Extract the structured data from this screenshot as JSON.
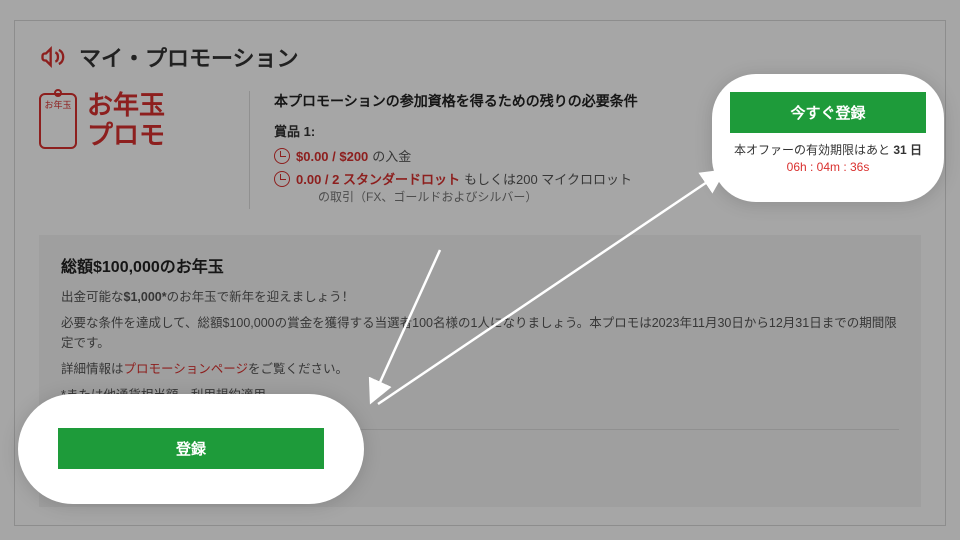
{
  "heading": "マイ・プロモーション",
  "logo": {
    "mark": "お年玉",
    "line1": "お年玉",
    "line2": "プロモ"
  },
  "req": {
    "title": "本プロモーションの参加資格を得るための残りの必要条件",
    "prize": "賞品 1:",
    "l1": "$0.00 / $200",
    "l1s": "の入金",
    "l2": "0.00 / 2 スタンダードロット",
    "l2s": "もしくは200 マイクロロット",
    "l2d": "の取引（FX、ゴールドおよびシルバー）"
  },
  "cta": {
    "topBtn": "今すぐ登録",
    "expPrefix": "本オファーの有効期限はあと ",
    "expDays": "31 日",
    "countdown": "06h : 04m : 36s",
    "bottomBtn": "登録"
  },
  "desc": {
    "h": "総額$100,000のお年玉",
    "p1a": "出金可能な",
    "p1b": "$1,000*",
    "p1c": "のお年玉で新年を迎えましょう！",
    "p2": "必要な条件を達成して、総額$100,000の賞金を獲得する当選者100名様の1人になりましょう。本プロモは2023年11月30日から12月31日までの期間限定です。",
    "p3a": "詳細情報は",
    "p3link": "プロモーションページ",
    "p3b": "をご覧ください。",
    "p4": "*または他通貨相当額。利用規約適用。"
  }
}
